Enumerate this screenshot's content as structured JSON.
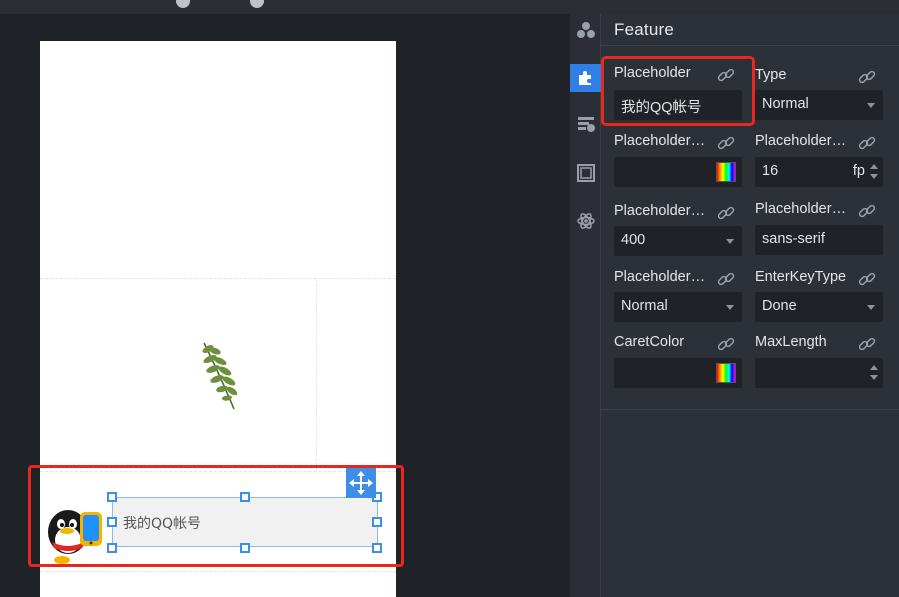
{
  "canvas": {
    "input_placeholder": "我的QQ帐号"
  },
  "panel": {
    "title": "Feature",
    "props": {
      "placeholder": {
        "label": "Placeholder",
        "value": "我的QQ帐号"
      },
      "type": {
        "label": "Type",
        "value": "Normal"
      },
      "placeholder_color": {
        "label": "Placeholder…"
      },
      "placeholder_size": {
        "label": "Placeholder…",
        "value": "16",
        "unit": "fp"
      },
      "placeholder_weight": {
        "label": "Placeholder…",
        "value": "400"
      },
      "placeholder_family": {
        "label": "Placeholder…",
        "value": "sans-serif"
      },
      "placeholder_style": {
        "label": "Placeholder…",
        "value": "Normal"
      },
      "enter_key_type": {
        "label": "EnterKeyType",
        "value": "Done"
      },
      "caret_color": {
        "label": "CaretColor"
      },
      "max_length": {
        "label": "MaxLength",
        "value": ""
      }
    }
  },
  "colors": {
    "accent": "#2f7fe6",
    "highlight": "#e8271f",
    "panel_bg": "#2c3037"
  },
  "icons": {
    "rail": [
      "components-icon",
      "puzzle-icon",
      "events-icon",
      "frame-icon",
      "atom-icon"
    ],
    "link": "link-icon",
    "move": "move-arrows-icon"
  }
}
